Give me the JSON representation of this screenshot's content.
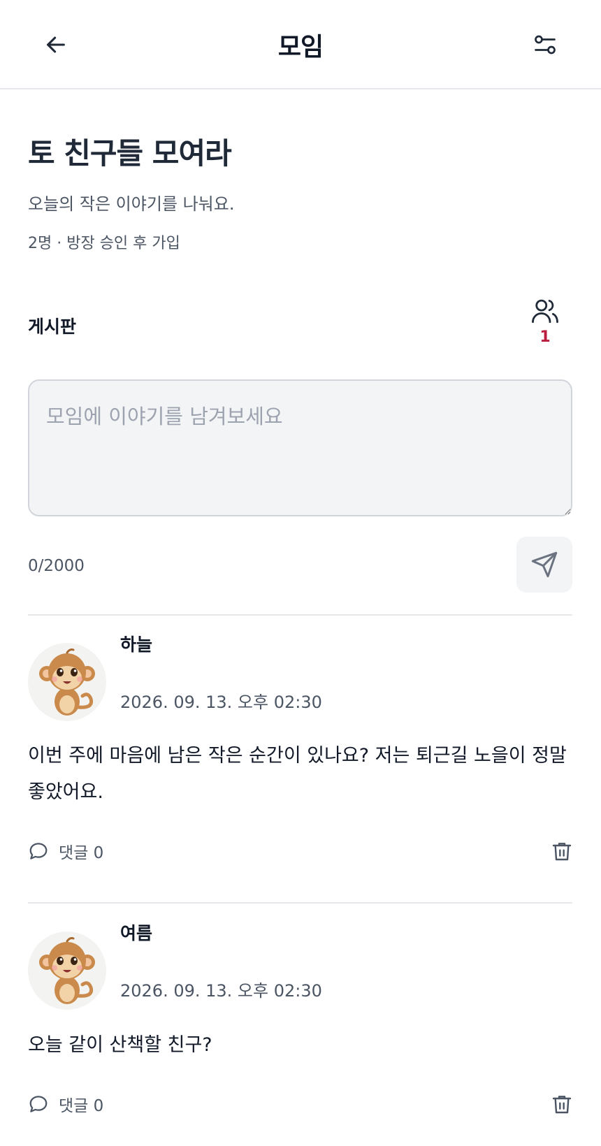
{
  "header": {
    "title": "모임",
    "back_icon": "arrow-left-icon",
    "filter_icon": "sliders-icon"
  },
  "group": {
    "title": "토 친구들 모여라",
    "description": "오늘의 작은 이야기를 나눠요.",
    "meta": "2명 · 방장 승인 후 가입"
  },
  "board": {
    "label": "게시판",
    "members_icon": "users-icon",
    "member_badge": "1"
  },
  "composer": {
    "placeholder": "모임에 이야기를 남겨보세요",
    "value": "",
    "char_count": "0/2000",
    "send_icon": "send-icon"
  },
  "posts": [
    {
      "author": "하늘",
      "timestamp": "2026. 09. 13. 오후 02:30",
      "body": "이번 주에 마음에 남은 작은 순간이 있나요? 저는 퇴근길 노을이 정말 좋았어요.",
      "comment_label": "댓글 0",
      "avatar_icon": "monkey-avatar-icon"
    },
    {
      "author": "여름",
      "timestamp": "2026. 09. 13. 오후 02:30",
      "body": "오늘 같이 산책할 친구?",
      "comment_label": "댓글 0",
      "avatar_icon": "monkey-avatar-icon"
    }
  ],
  "colors": {
    "text_primary": "#111827",
    "text_secondary": "#4b5563",
    "badge_red": "#b91c3c",
    "input_bg": "#f3f4f6",
    "divider": "#e5e7eb"
  }
}
